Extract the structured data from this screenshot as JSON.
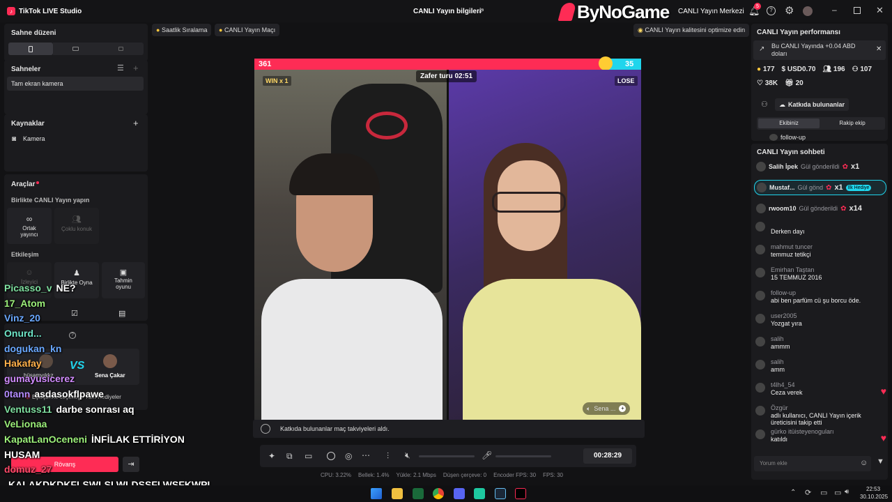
{
  "app": {
    "title": "TikTok LIVE Studio",
    "center_title": "CANLI Yayın bilgileri",
    "watermark": "ByNoGame",
    "live_center": "CANLI Yayın Merkezi",
    "notif_count": "5"
  },
  "left": {
    "scene_layout": "Sahne düzeni",
    "scenes_title": "Sahneler",
    "scene_item": "Tam ekran kamera",
    "sources_title": "Kaynaklar",
    "source_item": "Kamera",
    "tools_title": "Araçlar",
    "go_live_together": "Birlikte CANLI Yayın yapın",
    "co_host": "Ortak yayıncı",
    "multi_guest": "Çoklu konuk",
    "interaction": "Etkileşim",
    "poll": "İzleyici",
    "play_together": "Birlikte Oyna",
    "guess_game": "Tahmin oyunu",
    "match_host1": "hüsamyıldız",
    "match_host2": "Sena Çakar",
    "match_setting": "Eşleştirme seçeneği: Tüm Hediyeler",
    "rematch": "Rövanş"
  },
  "top_chips": {
    "hourly_rank": "Saatlik Sıralama",
    "live_match": "CANLI Yayın Maçı",
    "optimize": "CANLI Yayın kalitesini optimize edin"
  },
  "battle": {
    "score_left": "361",
    "score_right": "35",
    "timer": "Zafer turu 02:51",
    "win_label": "WIN x 1",
    "lose_label": "LOSE",
    "opponent_name": "Sena ..."
  },
  "notice": "Katkıda bulunanlar maç takviyeleri aldı.",
  "controls": {
    "elapsed": "00:28:29"
  },
  "stats": {
    "cpu": "CPU: 3.22%",
    "mem": "Bellek: 1.4%",
    "upload": "Yükle: 2.1 Mbps",
    "dropped": "Düşen çerçeve: 0",
    "enc_fps": "Encoder FPS: 30",
    "fps": "FPS: 30"
  },
  "performance": {
    "title": "CANLI Yayın performansı",
    "earnings": "Bu CANLI Yayında +0.04 ABD doları",
    "coins": "177",
    "usd": "USD0.70",
    "viewers": "196",
    "followers": "107",
    "likes": "38K",
    "gifts": "20",
    "contributors": "Katkıda bulunanlar",
    "tab_yours": "Ekibiniz",
    "tab_rival": "Rakip ekip",
    "follow_up": "follow-up"
  },
  "chat": {
    "title": "CANLI Yayın sohbeti",
    "gifts": [
      {
        "name": "Salih İpek",
        "text": "Gül gönderildi",
        "count": "x1"
      },
      {
        "name": "Mustaf...",
        "text": "Gül gönd",
        "count": "x1",
        "badge": "İlk Hediye"
      },
      {
        "name": "rwoom10",
        "text": "Gül gönderildi",
        "count": "x14"
      }
    ],
    "messages": [
      {
        "name": "",
        "text": "Derken dayı"
      },
      {
        "name": "mahmut tuncer",
        "text": "temmuz tetikçi"
      },
      {
        "name": "Emirhan Taştan",
        "text": "15 TEMMUZ 2016"
      },
      {
        "name": "follow-up",
        "text": "abi ben parfüm cü şu borcu öde."
      },
      {
        "name": "user2005",
        "text": "Yozgat yıra"
      },
      {
        "name": "salih",
        "text": "ammm"
      },
      {
        "name": "salih",
        "text": "amm"
      },
      {
        "name": "t4lh4_54",
        "text": "Ceza verek"
      },
      {
        "name": "Özgür",
        "text": "adlı kullanıcı, CANLI Yayın içerik üreticisini takip etti"
      },
      {
        "name": "gürko itüisteyenoguları",
        "text": "katıldı"
      }
    ],
    "input_placeholder": "Yorum ekle"
  },
  "overlay_chat": [
    {
      "name": "Picasso_v",
      "text": "NE?",
      "color": "#7fe0a0"
    },
    {
      "name": "17_Atom",
      "text": "",
      "color": "#9cf07a"
    },
    {
      "name": "Vinz_20",
      "text": "",
      "color": "#6aa8ff"
    },
    {
      "name": "Onurd...",
      "text": "",
      "color": "#6ee6c8"
    },
    {
      "name": "dogukan_kn",
      "text": "",
      "color": "#6aa8ff"
    },
    {
      "name": "Hakafay",
      "text": "",
      "color": "#ffb04a"
    },
    {
      "name": "gumayusicerez",
      "text": "",
      "color": "#d28cff"
    },
    {
      "name": "0tann",
      "text": "asdasokflpawe",
      "color": "#b48cff"
    },
    {
      "name": "Ventuss11",
      "text": "darbe sonrası aq",
      "color": "#7fe0a0"
    },
    {
      "name": "VeLionaa",
      "text": "",
      "color": "#9cf07a"
    },
    {
      "name": "KapatLanOceneni",
      "text": "İNFİLAK ETTİRİYON",
      "color": "#9cf07a"
    },
    {
      "name": "HUSAM",
      "text": "",
      "color": "#ffffff"
    },
    {
      "name": "domuz_27",
      "text": "",
      "color": "#ff4a6a"
    },
    {
      "name": "",
      "text": "KALAKDKDKFLŞWLSLWLDSŞFLWŞFKWPL",
      "color": "#ffffff"
    }
  ],
  "taskbar": {
    "time": "22:53",
    "date": "30.10.2025"
  },
  "colors": {
    "accent": "#fe2c55",
    "teal": "#20d5ec",
    "bg": "#121214"
  }
}
